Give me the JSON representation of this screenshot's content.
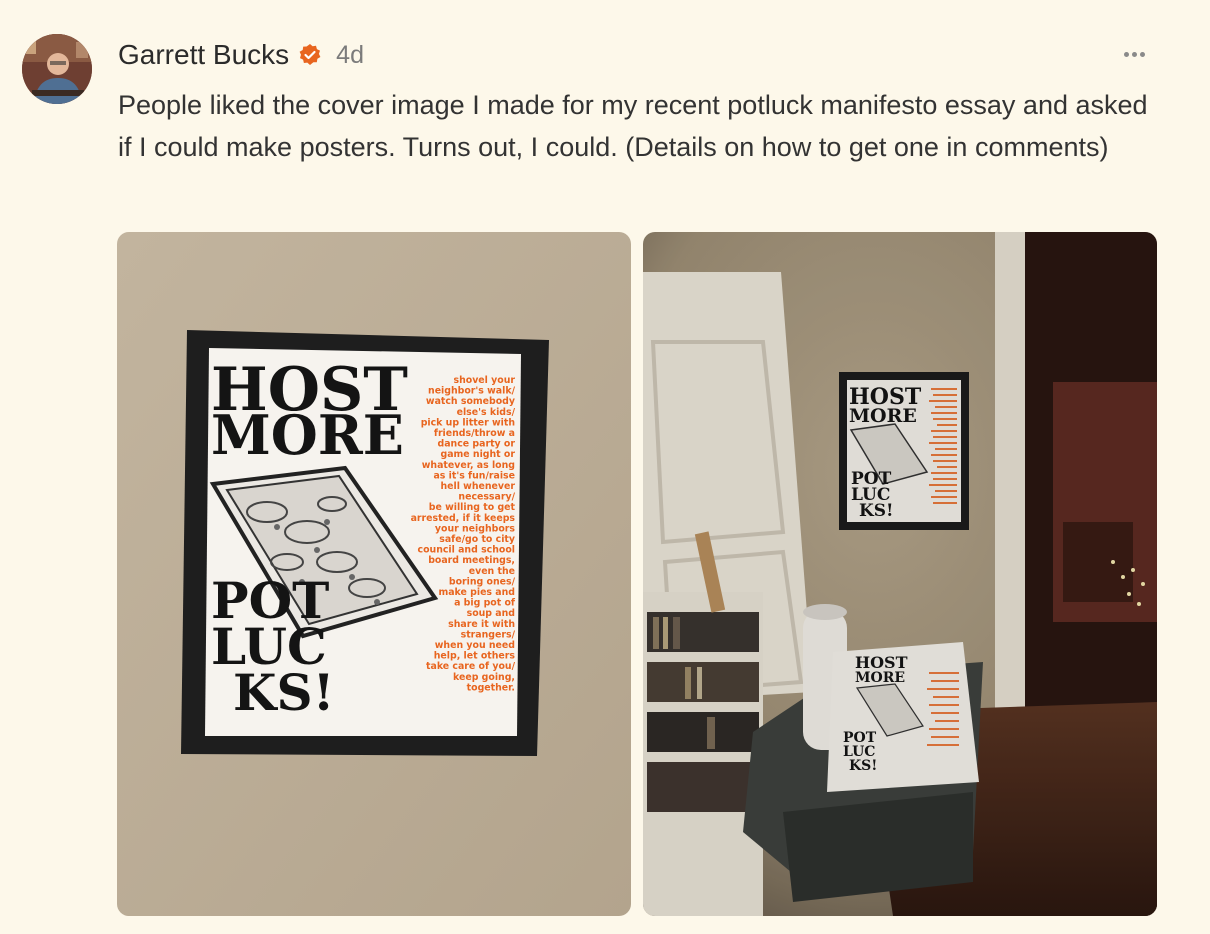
{
  "post": {
    "author": "Garrett Bucks",
    "age": "4d",
    "text": "People liked the cover image I made for my recent potluck manifesto essay and asked if I could make posters. Turns out, I could. (Details on how to get one in comments)"
  },
  "poster": {
    "headline_top": [
      "HOST",
      "MORE"
    ],
    "headline_bottom": [
      "POT",
      "LUC",
      "KS!"
    ],
    "side_text": [
      "shovel your",
      "neighbor's walk/",
      "watch somebody",
      "else's kids/",
      "pick up litter with",
      "friends/throw a",
      "dance party or",
      "game night or",
      "whatever, as long",
      "as it's fun/raise",
      "hell whenever",
      "necessary/",
      "be willing to get",
      "arrested, if it keeps",
      "your neighbors",
      "safe/go to city",
      "council and school",
      "board meetings,",
      "even the",
      "boring ones/",
      "make pies and",
      "a big pot of",
      "soup and",
      "share it with",
      "strangers/",
      "when you need",
      "help, let others",
      "take care of you/",
      "keep going,",
      "together."
    ]
  },
  "colors": {
    "accent": "#e8651f",
    "background": "#fdf8ea",
    "wall": "#bdae98"
  }
}
